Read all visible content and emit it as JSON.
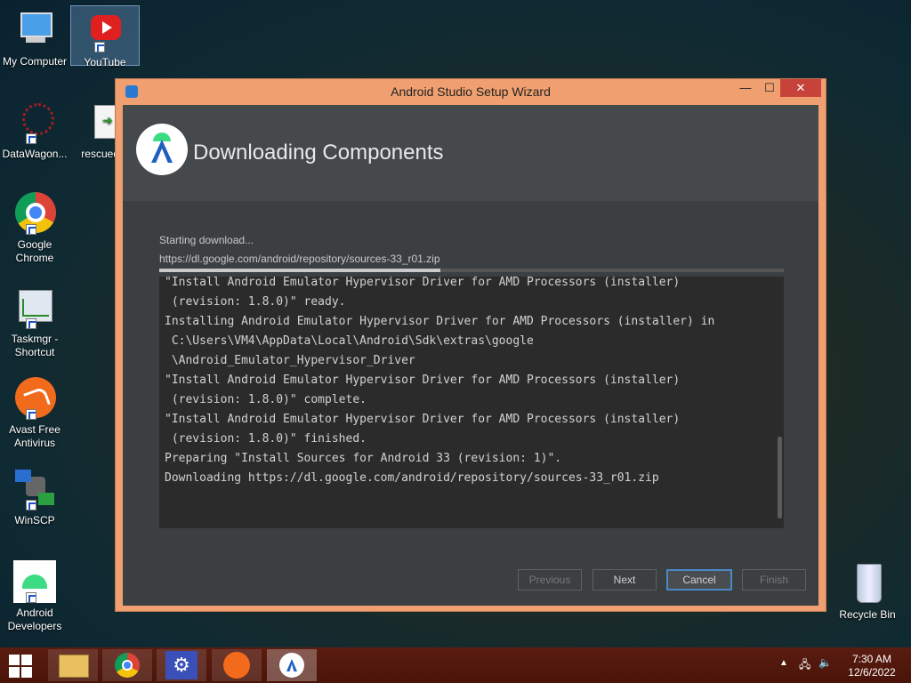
{
  "desktop": {
    "icons": [
      {
        "label": "My Computer"
      },
      {
        "label": "YouTube"
      },
      {
        "label": "DataWagon..."
      },
      {
        "label": "rescued"
      },
      {
        "label": "Google Chrome"
      },
      {
        "label": "Taskmgr - Shortcut"
      },
      {
        "label": "Avast Free Antivirus"
      },
      {
        "label": "WinSCP"
      },
      {
        "label": "Android Developers"
      },
      {
        "label": "Recycle Bin"
      }
    ]
  },
  "window": {
    "title": "Android Studio Setup Wizard",
    "header_title": "Downloading Components",
    "status": "Starting download...",
    "url": "https://dl.google.com/android/repository/sources-33_r01.zip",
    "progress": 0.45,
    "log": "\"Install Android Emulator Hypervisor Driver for AMD Processors (installer)\n (revision: 1.8.0)\" ready.\nInstalling Android Emulator Hypervisor Driver for AMD Processors (installer) in\n C:\\Users\\VM4\\AppData\\Local\\Android\\Sdk\\extras\\google\n \\Android_Emulator_Hypervisor_Driver\n\"Install Android Emulator Hypervisor Driver for AMD Processors (installer)\n (revision: 1.8.0)\" complete.\n\"Install Android Emulator Hypervisor Driver for AMD Processors (installer)\n (revision: 1.8.0)\" finished.\nPreparing \"Install Sources for Android 33 (revision: 1)\".\nDownloading https://dl.google.com/android/repository/sources-33_r01.zip",
    "buttons": {
      "previous": "Previous",
      "next": "Next",
      "cancel": "Cancel",
      "finish": "Finish"
    }
  },
  "taskbar": {
    "time": "7:30 AM",
    "date": "12/6/2022"
  },
  "colors": {
    "window_border": "#f0a070",
    "close_button": "#c7423a",
    "taskbar": "#4a1409"
  }
}
